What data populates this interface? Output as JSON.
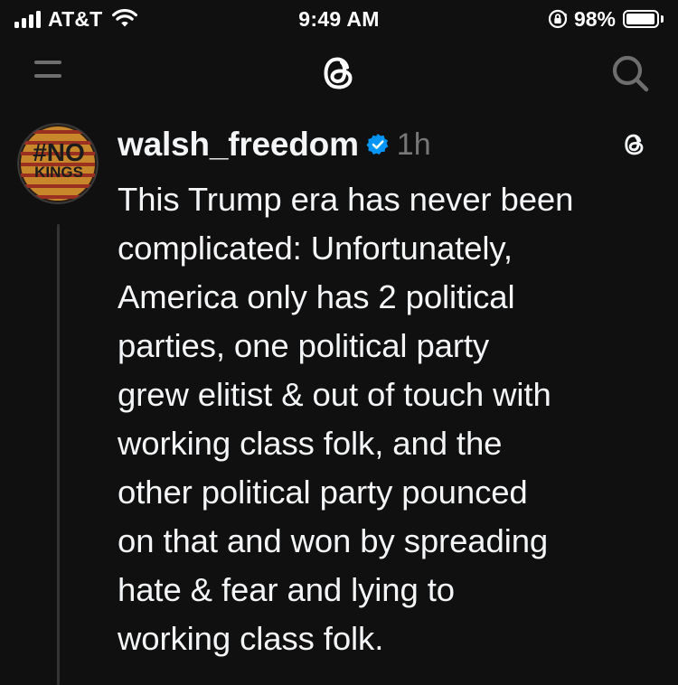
{
  "status_bar": {
    "carrier": "AT&T",
    "time": "9:49 AM",
    "battery_percent": "98%",
    "battery_level": 0.98,
    "signal_icon": "cellular-signal-icon",
    "wifi_icon": "wifi-icon",
    "lock_icon": "orientation-lock-icon"
  },
  "nav": {
    "menu_icon": "menu-icon",
    "logo_icon": "threads-logo-icon",
    "search_icon": "search-icon"
  },
  "post": {
    "username": "walsh_freedom",
    "verified": true,
    "time_ago": "1h",
    "avatar_text_top": "#NO",
    "avatar_text_bottom": "KINGS",
    "body_lines": [
      "This Trump era has never been",
      "complicated: Unfortunately,",
      "America only has 2 political",
      "parties, one political party",
      "grew elitist & out of touch with",
      "working class folk, and the",
      "other political party pounced",
      "on that and won by spreading",
      "hate & fear and lying to",
      "working class folk."
    ]
  },
  "colors": {
    "background": "#101010",
    "text": "#f3f5f7",
    "muted": "#777777",
    "verified": "#0095f6"
  }
}
